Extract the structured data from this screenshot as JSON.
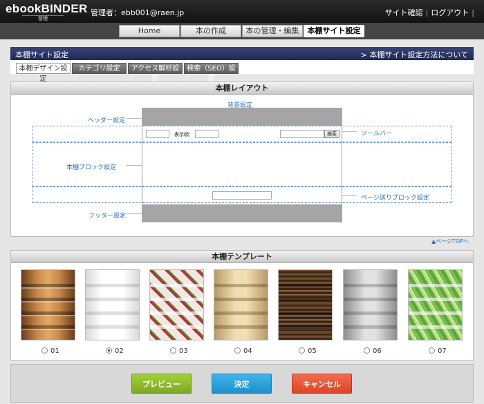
{
  "header": {
    "logo": "ebookBINDER",
    "logo_sub": "管理",
    "admin_label": "管理者：ebb001@raen.jp",
    "site_check": "サイト確認",
    "logout": "ログアウト"
  },
  "nav": {
    "tabs": [
      {
        "label": "Home"
      },
      {
        "label": "本の作成"
      },
      {
        "label": "本の管理・編集"
      },
      {
        "label": "本棚サイト設定",
        "active": true
      }
    ]
  },
  "section": {
    "title": "本棚サイト設定",
    "help_link": "> 本棚サイト設定方法について"
  },
  "subtabs": [
    {
      "label": "本棚デザイン設定",
      "active": true
    },
    {
      "label": "カテゴリ設定"
    },
    {
      "label": "アクセス解析設定"
    },
    {
      "label": "検索（SEO）設定"
    }
  ],
  "layout_panel": {
    "title": "本棚レイアウト",
    "background_setting": "背景設定",
    "header_setting": "ヘッダー設定",
    "toolbar": "ツールバー",
    "block_setting": "本棚ブロック設定",
    "pager_setting": "ページ送りブロック設定",
    "footer_setting": "フッター設定",
    "sort_label": "表示順：",
    "search_button": "検索"
  },
  "page_top": "▲ページTOPへ",
  "template_panel": {
    "title": "本棚テンプレート",
    "options": [
      {
        "label": "01",
        "selected": false
      },
      {
        "label": "02",
        "selected": true
      },
      {
        "label": "03",
        "selected": false
      },
      {
        "label": "04",
        "selected": false
      },
      {
        "label": "05",
        "selected": false
      },
      {
        "label": "06",
        "selected": false
      },
      {
        "label": "07",
        "selected": false
      }
    ]
  },
  "actions": {
    "preview": "プレビュー",
    "ok": "決定",
    "cancel": "キャンセル"
  },
  "colors": {
    "preview": "#8cba2e",
    "ok": "#2fa3dd",
    "cancel": "#e85538",
    "section_bar": "#2b3566",
    "link": "#2a6ebb"
  }
}
